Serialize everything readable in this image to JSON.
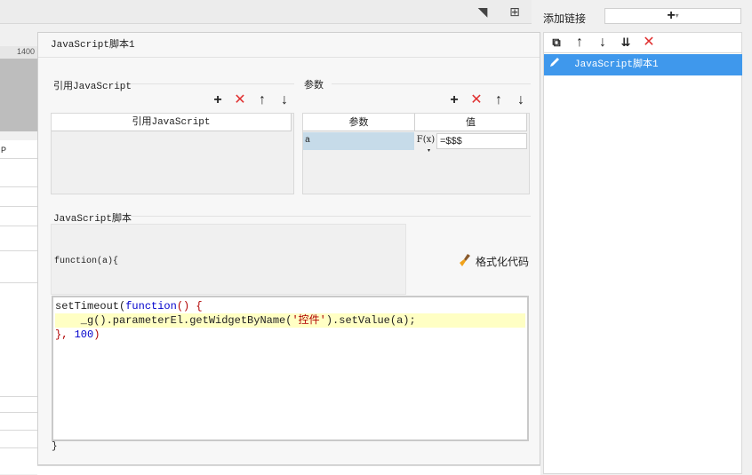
{
  "background": {
    "ruler_label": "1400",
    "col_letter": "P"
  },
  "dialog": {
    "title": "JavaScript脚本1",
    "ref_section_label": "引用JavaScript",
    "ref_table_header": "引用JavaScript",
    "params_section_label": "参数",
    "params_headers": [
      "参数",
      "值"
    ],
    "params_rows": [
      {
        "name": "a",
        "formula_icon": "F(x)",
        "value": "=$$$"
      }
    ],
    "script_section_label": "JavaScript脚本",
    "function_signature": "function(a){",
    "format_label": "格式化代码",
    "closing_brace": "}",
    "code": {
      "line1_a": "setTimeout(",
      "line1_kw": "function",
      "line1_b": "() {",
      "line2_a": "    _g().parameterEl.getWidgetByName(",
      "line2_str": "'控件'",
      "line2_b": ").setValue(a);",
      "line3_a": "}, ",
      "line3_num": "100",
      "line3_b": ")"
    }
  },
  "right_panel": {
    "add_link_label": "添加链接",
    "add_link_button": "+",
    "list_items": [
      "JavaScript脚本1"
    ]
  },
  "colors": {
    "selection_blue": "#3f98ec",
    "delete_red": "#e03030",
    "highlight_yellow": "#ffffc4"
  }
}
